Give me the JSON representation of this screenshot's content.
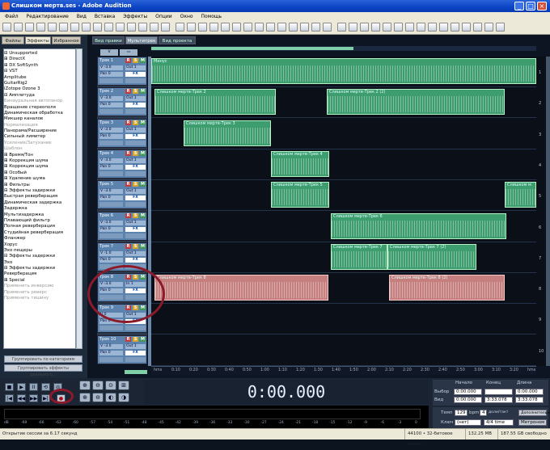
{
  "window": {
    "title": "Слишком мертв.ses - Adobe Audition",
    "controls": [
      "_",
      "□",
      "×"
    ]
  },
  "menu": [
    "Файл",
    "Редактирование",
    "Вид",
    "Вставка",
    "Эффекты",
    "Опции",
    "Окно",
    "Помощь"
  ],
  "left_panel": {
    "tabs": [
      "Файлы",
      "Эффекты",
      "Избранное"
    ],
    "tree": [
      "⊟ Unsupported",
      "   ⊞ DirectX",
      "   ⊞ DX SoftSynth",
      "⊟ VST",
      "      Amplitube",
      "      GuitarRig2",
      "      iZotope Ozone 3",
      "⊟ Амплитуда",
      "      Бинауральная автопанор.",
      "      Вращение стереополя",
      "      Динамическая обработка",
      "      Микшер каналов",
      "      Нормализация",
      "      Панорама/Расширение",
      "      Сильный лимитер",
      "      Усиление/Затухание",
      "      Шаблон",
      "⊞ Время/Тон",
      "⊞ Коррекция шума",
      "⊞ Коррекция шума",
      "⊞ Особый",
      "⊞ Удаление шума",
      "⊞ Фильтры",
      "⊟ Эффекты задержки",
      "      Быстрая реверберация",
      "      Динамическая задержка",
      "      Задержка",
      "      Мультизадержка",
      "      Плавающий фильтр",
      "      Полная реверберация",
      "      Студийная реверберация",
      "      Фланжер",
      "      Хорус",
      "      Эхо пещеры",
      "⊟ Эффекты задержки",
      "      Эхо",
      "⊟ Эффекты задержки",
      "      Реверберация",
      "⊞ Special",
      "   Применить инверсию",
      "   Применить реверс",
      "   Применить тишину"
    ],
    "greyed_rows": [
      8,
      12,
      15,
      16,
      39,
      40,
      41
    ],
    "buttons": [
      "Группировать по категориям",
      "Группировать эффекты реального..."
    ]
  },
  "views": [
    "Вид правки",
    "Мультитрек",
    "Вид проекта CD"
  ],
  "active_view": 1,
  "tracks": [
    {
      "name": "Трек 1",
      "vol": "V -3.0",
      "pan": "Pan 0",
      "io": "Out 1"
    },
    {
      "name": "Трек 2",
      "vol": "V -3.0",
      "pan": "Pan 0",
      "io": "Out 1"
    },
    {
      "name": "Трек 3",
      "vol": "V -3.0",
      "pan": "Pan 0",
      "io": "Out 1"
    },
    {
      "name": "Трек 4",
      "vol": "V -3.0",
      "pan": "Pan 0",
      "io": "Out 1"
    },
    {
      "name": "Трек 5",
      "vol": "V -3.0",
      "pan": "Pan 0",
      "io": "Out 1"
    },
    {
      "name": "Трек 6",
      "vol": "V -3.0",
      "pan": "Pan 0",
      "io": "Out 1"
    },
    {
      "name": "Трек 7",
      "vol": "V -1.0",
      "pan": "Pan 0",
      "io": "Out 1"
    },
    {
      "name": "Трек 8",
      "vol": "V -3.0",
      "pan": "Pan 0",
      "io": "In 1"
    },
    {
      "name": "Трек 9",
      "vol": "V 0",
      "pan": "Pan 0",
      "io": "Out 1"
    },
    {
      "name": "Трек 10",
      "vol": "V -3.0",
      "pan": "Pan 0",
      "io": "Out 1"
    }
  ],
  "track_buttons": {
    "rec": "R",
    "solo": "S",
    "mute": "M",
    "fx": "FX"
  },
  "clip_labels": {
    "lane1": "Минус",
    "lane2a": "Слишком мертв-Трек 2",
    "lane2b": "Слишком мертв-Трек 2 (2)",
    "lane3": "Слишком мертв-Трек 3",
    "lane4": "Слишком мертв-Трек 4",
    "lane5a": "Слишком мертв-Трек 5",
    "lane5b": "Слишком м",
    "lane6": "Слишком мертв-Трек 6",
    "lane7a": "Слишком мертв-Трек 7",
    "lane7b": "Слишком мертв-Трек 7 (2)",
    "lane8a": "Слишком мертв-Трек 8",
    "lane8b": "Слишком мертв-Трек 8 (2)"
  },
  "track_numbers": [
    "1",
    "2",
    "3",
    "4",
    "5",
    "6",
    "7",
    "8",
    "9",
    "10"
  ],
  "ruler": [
    "hms",
    "0:10",
    "0:20",
    "0:30",
    "0:40",
    "0:50",
    "1:00",
    "1:10",
    "1:20",
    "1:30",
    "1:40",
    "1:50",
    "2:00",
    "2:10",
    "2:20",
    "2:30",
    "2:40",
    "2:50",
    "3:00",
    "3:10",
    "3:20",
    "hms"
  ],
  "transport": {
    "row1": [
      "■",
      "▶",
      "II",
      "⟲",
      "◎"
    ],
    "row2": [
      "|◀",
      "◀◀",
      "▶▶",
      "▶|",
      "●"
    ]
  },
  "zoom_icons": [
    "zoom-in-horizontal",
    "zoom-out-horizontal",
    "zoom-full",
    "zoom-selection",
    "zoom-in-vertical",
    "zoom-out-vertical",
    "zoom-left",
    "zoom-right"
  ],
  "time_display": "0:00.000",
  "selection": {
    "headers": [
      "Начало",
      "Конец",
      "Длина"
    ],
    "rows": [
      {
        "label": "Выбор",
        "start": "0:00.000",
        "end": "",
        "length": "0:00.000"
      },
      {
        "label": "Вид",
        "start": "0:00.000",
        "end": "3:33.078",
        "length": "3:33.078"
      }
    ]
  },
  "meter_scale": [
    "dB",
    "-69",
    "-66",
    "-63",
    "-60",
    "-57",
    "-54",
    "-51",
    "-48",
    "-45",
    "-42",
    "-39",
    "-36",
    "-33",
    "-30",
    "-27",
    "-24",
    "-21",
    "-18",
    "-15",
    "-12",
    "-9",
    "-6",
    "-3",
    "0"
  ],
  "tempo": {
    "tempo_label": "Темп",
    "tempo_value": "129",
    "bpm_label": "bpm",
    "beats_value": "4",
    "beats_label": "доли/такт",
    "advanced": "Дополнительно...",
    "key_label": "Ключ",
    "key_value": "(нет)",
    "time_sig": "4/4 time",
    "metronome": "Метроном"
  },
  "status": {
    "message": "Открытие сессии за 6.17 секунд",
    "format": "44100 • 32-битовое микш.",
    "mem": "132.25 MB",
    "free": "187.55 GB свободно"
  },
  "colors": {
    "track_header": "#5b83ad",
    "clip_green": "#3d9d6e",
    "clip_red": "#c67f7f",
    "annotation_ring": "#8c1a2a"
  }
}
